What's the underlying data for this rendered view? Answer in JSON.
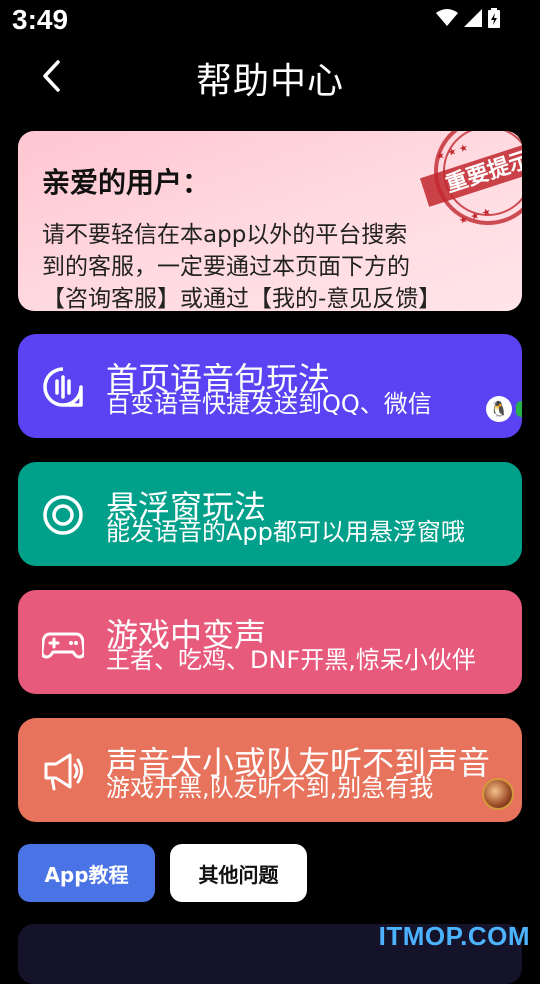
{
  "status_bar": {
    "time": "3:49"
  },
  "header": {
    "title": "帮助中心"
  },
  "notice": {
    "greeting": "亲爱的用户：",
    "line1": "请不要轻信在本app以外的平台搜索",
    "line2": "到的客服，一定要通过本页面下方的",
    "line3": "【咨询客服】或通过【我的-意见反馈】",
    "stamp_text": "重要提示"
  },
  "features": [
    {
      "title": "首页语音包玩法",
      "subtitle": "百变语音快捷发送到QQ、微信",
      "color": "#5b43f3"
    },
    {
      "title": "悬浮窗玩法",
      "subtitle": "能发语音的App都可以用悬浮窗哦",
      "color": "#00a08a"
    },
    {
      "title": "游戏中变声",
      "subtitle": "王者、吃鸡、DNF开黑,惊呆小伙伴",
      "color": "#e85a7c"
    },
    {
      "title": "声音太小或队友听不到声音",
      "subtitle": "游戏开黑,队友听不到,别急有我",
      "color": "#e8735c"
    }
  ],
  "tabs": {
    "app_tutorial": "App教程",
    "other_questions": "其他问题"
  },
  "watermark": "ITMOP.COM"
}
